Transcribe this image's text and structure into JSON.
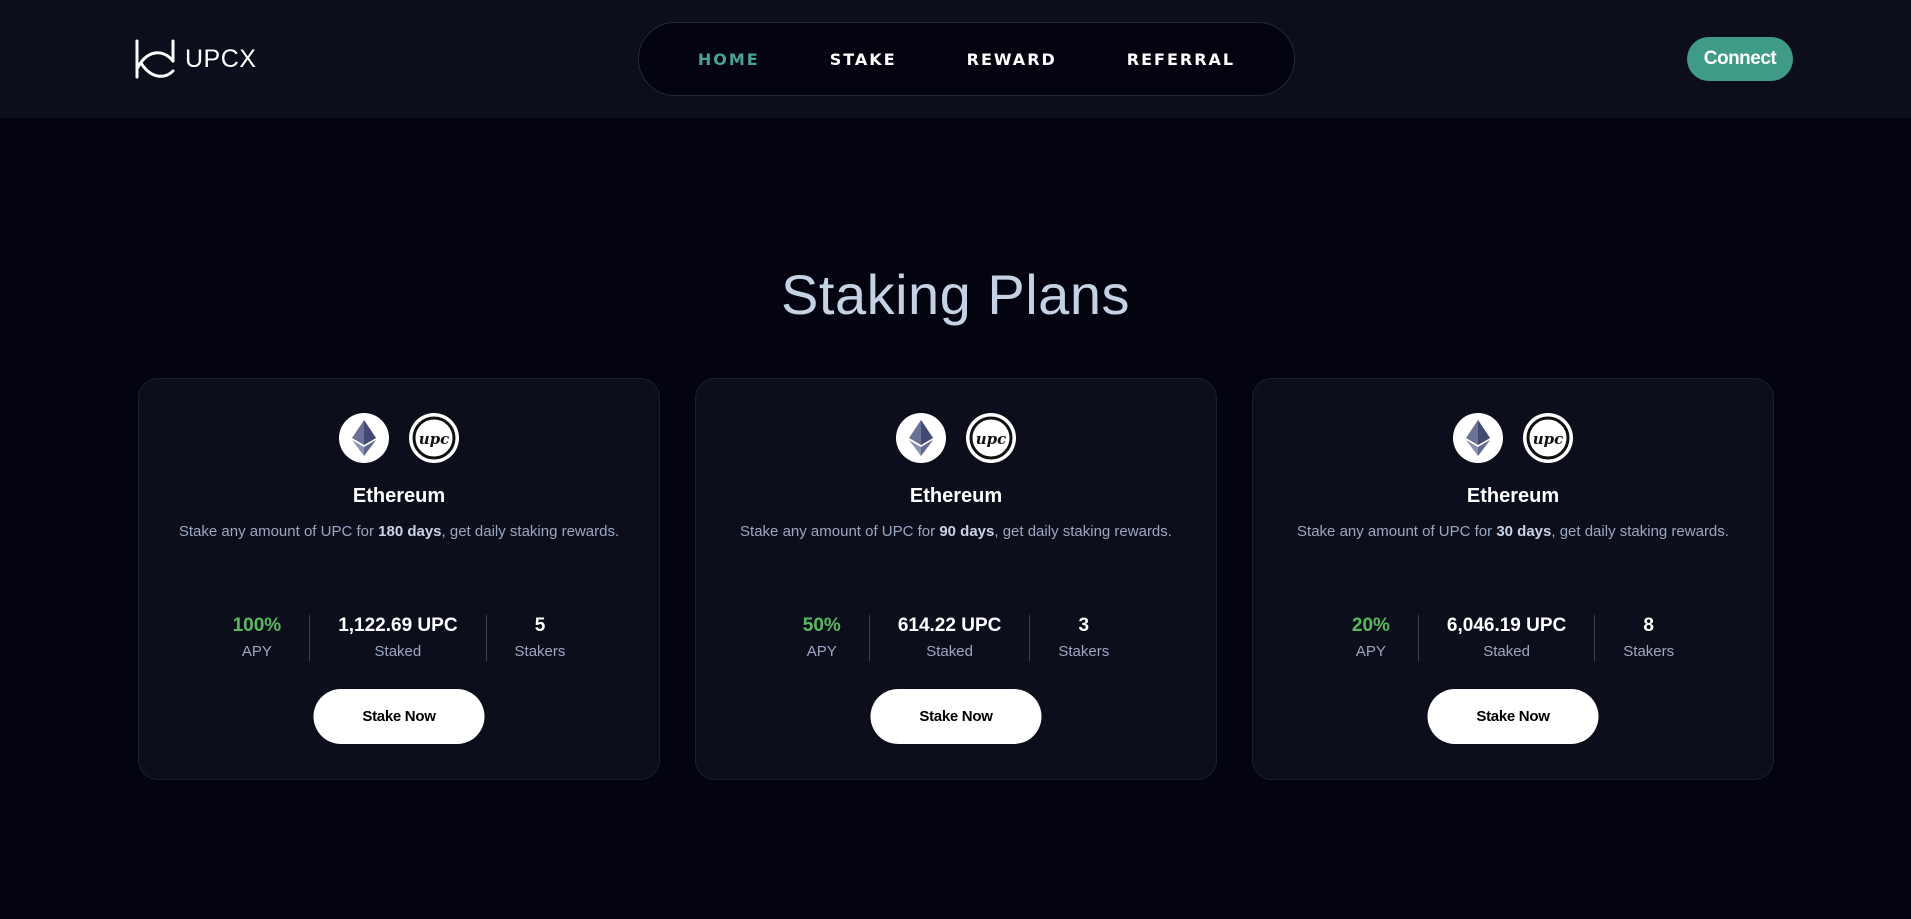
{
  "header": {
    "logo_text": "UPCX",
    "nav": [
      {
        "label": "HOME",
        "active": true
      },
      {
        "label": "STAKE",
        "active": false
      },
      {
        "label": "REWARD",
        "active": false
      },
      {
        "label": "REFERRAL",
        "active": false
      }
    ],
    "connect_label": "Connect"
  },
  "section": {
    "title": "Staking Plans"
  },
  "cards": [
    {
      "coins": [
        "ethereum-icon",
        "upc-icon"
      ],
      "title": "Ethereum",
      "desc_prefix": "Stake any amount of UPC for ",
      "desc_bold": "180 days",
      "desc_suffix": ", get daily staking rewards.",
      "apy_value": "100%",
      "apy_label": "APY",
      "staked_value": "1,122.69 UPC",
      "staked_label": "Staked",
      "stakers_value": "5",
      "stakers_label": "Stakers",
      "button_label": "Stake Now"
    },
    {
      "coins": [
        "ethereum-icon",
        "upc-icon"
      ],
      "title": "Ethereum",
      "desc_prefix": "Stake any amount of UPC for ",
      "desc_bold": "90 days",
      "desc_suffix": ", get daily staking rewards.",
      "apy_value": "50%",
      "apy_label": "APY",
      "staked_value": "614.22 UPC",
      "staked_label": "Staked",
      "stakers_value": "3",
      "stakers_label": "Stakers",
      "button_label": "Stake Now"
    },
    {
      "coins": [
        "ethereum-icon",
        "upc-icon"
      ],
      "title": "Ethereum",
      "desc_prefix": "Stake any amount of UPC for ",
      "desc_bold": "30 days",
      "desc_suffix": ", get daily staking rewards.",
      "apy_value": "20%",
      "apy_label": "APY",
      "staked_value": "6,046.19 UPC",
      "staked_label": "Staked",
      "stakers_value": "8",
      "stakers_label": "Stakers",
      "button_label": "Stake Now"
    }
  ],
  "colors": {
    "accent": "#3f9a86",
    "nav_active": "#49a391",
    "apy_green": "#5ab85f",
    "background": "#03040f",
    "card": "#0c0f1b"
  }
}
